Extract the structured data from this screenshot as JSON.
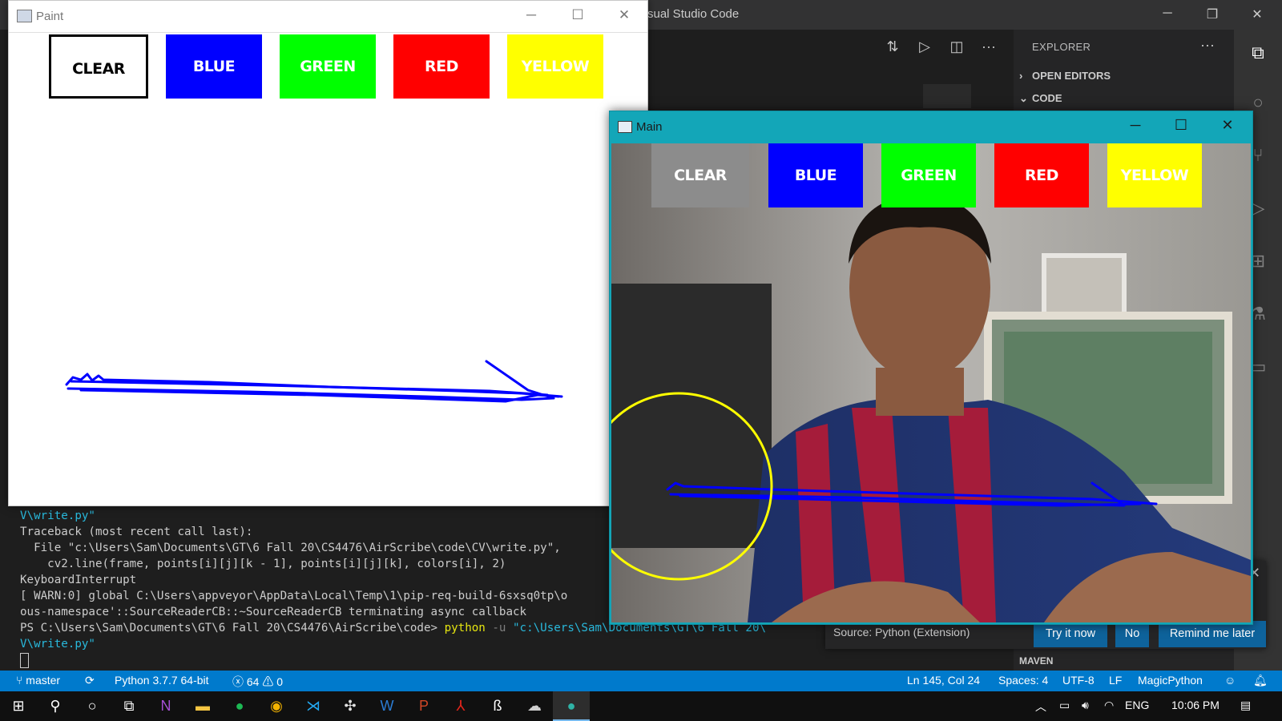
{
  "vscode": {
    "title_fragment": "sual Studio Code",
    "explorer_title": "EXPLORER",
    "sections": [
      "OPEN EDITORS",
      "CODE"
    ],
    "maven_label": "MAVEN"
  },
  "paint": {
    "title": "Paint",
    "buttons": [
      {
        "label": "CLEAR",
        "bg": "#ffffff",
        "fg": "#000000"
      },
      {
        "label": "BLUE",
        "bg": "#0000ff",
        "fg": "#ffffff"
      },
      {
        "label": "GREEN",
        "bg": "#00ff00",
        "fg": "#ffffff"
      },
      {
        "label": "RED",
        "bg": "#ff0000",
        "fg": "#ffffff"
      },
      {
        "label": "YELLOW",
        "bg": "#ffff00",
        "fg": "#ffffff"
      }
    ],
    "stroke_color": "#0000ff"
  },
  "main": {
    "title": "Main",
    "buttons": [
      {
        "label": "CLEAR",
        "bg": "#8c8c8c",
        "fg": "#ffffff"
      },
      {
        "label": "BLUE",
        "bg": "#0000ff",
        "fg": "#ffffff"
      },
      {
        "label": "GREEN",
        "bg": "#00ff00",
        "fg": "#ffffff"
      },
      {
        "label": "RED",
        "bg": "#ff0000",
        "fg": "#ffffff"
      },
      {
        "label": "YELLOW",
        "bg": "#ffff00",
        "fg": "#ffffff"
      }
    ],
    "tracker_color": "#ffff00"
  },
  "terminal": {
    "line1": "V\\write.py\"",
    "line2": "Traceback (most recent call last):",
    "line3": "  File \"c:\\Users\\Sam\\Documents\\GT\\6 Fall 20\\CS4476\\AirScribe\\code\\CV\\write.py\",",
    "line4": "    cv2.line(frame, points[i][j][k - 1], points[i][j][k], colors[i], 2)",
    "line5": "KeyboardInterrupt",
    "line6": "[ WARN:0] global C:\\Users\\appveyor\\AppData\\Local\\Temp\\1\\pip-req-build-6sxsq0tp\\o",
    "line7": "ous-namespace'::SourceReaderCB::~SourceReaderCB terminating async callback",
    "prompt": "PS C:\\Users\\Sam\\Documents\\GT\\6 Fall 20\\CS4476\\AirScribe\\code> ",
    "cmd": "python",
    "flag": " -u ",
    "path": "\"c:\\Users\\Sam\\Documents\\GT\\6 Fall 20\\",
    "line9": "V\\write.py\""
  },
  "notification": {
    "source": "Source: Python (Extension)",
    "try_now": "Try it now",
    "no": "No",
    "remind": "Remind me later"
  },
  "statusbar": {
    "branch": "master",
    "python": "Python 3.7.7 64-bit",
    "errors": "64",
    "warnings": "0",
    "position": "Ln 145, Col 24",
    "spaces": "Spaces: 4",
    "encoding": "UTF-8",
    "eol": "LF",
    "language": "MagicPython"
  },
  "taskbar": {
    "language": "ENG",
    "time": "10:06 PM"
  }
}
